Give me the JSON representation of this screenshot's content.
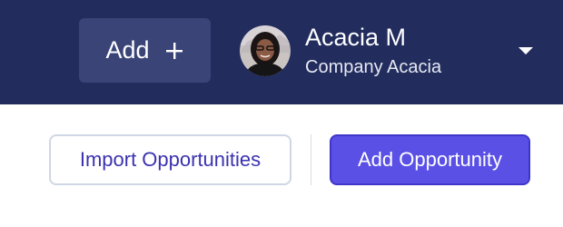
{
  "header": {
    "add_button_label": "Add",
    "add_button_icon": "plus-icon",
    "user": {
      "name": "Acacia M",
      "company": "Company Acacia",
      "avatar_icon": "user-avatar"
    },
    "menu_icon": "caret-down-icon"
  },
  "actions": {
    "import_label": "Import Opportunities",
    "add_opportunity_label": "Add Opportunity"
  },
  "colors": {
    "topbar": "#222d5e",
    "add_button_bg": "#3a4477",
    "primary": "#5a50e6",
    "import_text": "#3b32b0"
  }
}
